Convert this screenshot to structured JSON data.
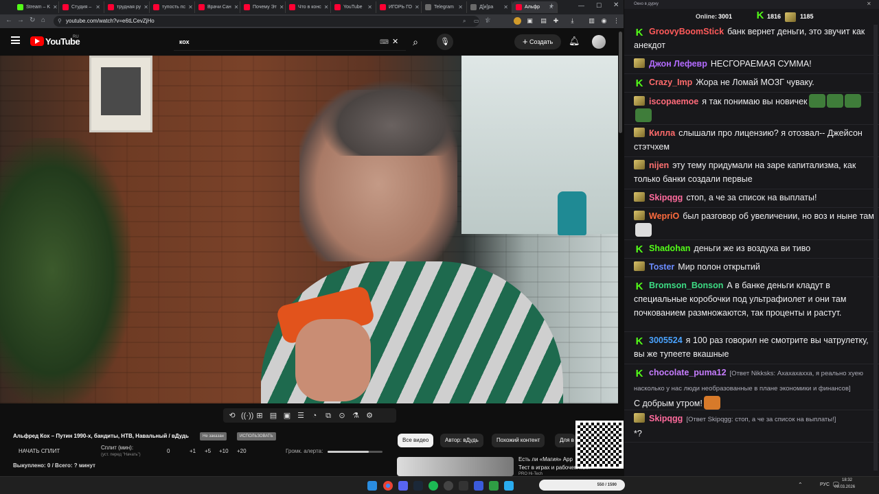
{
  "browser": {
    "tabs": [
      {
        "label": "Stream – K",
        "color": "#53fc18"
      },
      {
        "label": "Студия –",
        "color": "#ff0033"
      },
      {
        "label": "трудная ру",
        "color": "#ff0033"
      },
      {
        "label": "тупость пс",
        "color": "#ff0033"
      },
      {
        "label": "Врачи Сан",
        "color": "#ff0033"
      },
      {
        "label": "Почему Эт",
        "color": "#ff0033"
      },
      {
        "label": "Что в конс",
        "color": "#ff0033"
      },
      {
        "label": "YouTube",
        "color": "#ff0033"
      },
      {
        "label": "ИГОРЬ ГО",
        "color": "#ff0033"
      },
      {
        "label": "Telegram",
        "color": "#6a6a6a"
      },
      {
        "label": "Д[и]ра",
        "color": "#6a6a6a"
      },
      {
        "label": "Альфр",
        "color": "#ff0033"
      }
    ],
    "new_tab": "+",
    "url": "youtube.com/watch?v=e6tLCevZjHo"
  },
  "youtube": {
    "logo": "YouTube",
    "region": "RU",
    "search_value": "кох",
    "create_label": "Создать",
    "icons": [
      "menu-icon",
      "search-icon",
      "mic-icon",
      "bell-icon"
    ]
  },
  "panel": {
    "video_title": "Альфред Кох – Путин 1990-х, бандиты, НТВ, Навальный / вДудь",
    "chip1": "Не заказан",
    "chip2": "ИСПОЛЬЗОВАТЬ",
    "start_split": "НАЧАТЬ СПЛИТ",
    "split_label": "Сплит (мин):",
    "split_hint": "(уст. перед \"Начать\")",
    "split_values": [
      "0",
      "+1",
      "+5",
      "+10",
      "+20"
    ],
    "alert_label": "Громк. алерта:",
    "alert_level": 0.75,
    "bought": "Выкуплено: 0 / Всего: ? минут",
    "filters": [
      "Все видео",
      "Автор: вДудь",
      "Похожий контент",
      "Для в"
    ],
    "rec_title": "Есть ли «Магия» App",
    "rec_sub": "Тест в играх и рабочем по...",
    "rec_channel": "PRO Hi-Tech"
  },
  "chat": {
    "window_title": "Окно в дурку",
    "online_label": "Online:",
    "online_value": "3001",
    "count1": "1816",
    "count2": "1185",
    "messages": [
      {
        "badge": "k",
        "user": "GroovyBoomStick",
        "color": "#ff5a5a",
        "text": "банк вернет деньги, это звучит как анекдот"
      },
      {
        "badge": "m",
        "user": "Джон Лефевр",
        "color": "#b36bff",
        "text": "НЕСГОРАЕМАЯ СУММА!"
      },
      {
        "badge": "k",
        "user": "Crazy_Imp",
        "color": "#ff6b6b",
        "text": "Жора не Ломай МОЗГ чуваку."
      },
      {
        "badge": "m",
        "user": "iscopaemoe",
        "color": "#ff6b7a",
        "text": "я так понимаю вы новичек"
      },
      {
        "badge": "m",
        "user": "Килла",
        "color": "#ff6b6b",
        "text": "слышали про лицензию? я отозвал-- Джейсон стэтчхем"
      },
      {
        "badge": "m",
        "user": "nijen",
        "color": "#ff7070",
        "text": "эту тему придумали на заре капитализма, как только банки создали первые"
      },
      {
        "badge": "m",
        "user": "Skipqgg",
        "color": "#ff6b9d",
        "text": "стоп, а че за список на выплаты!"
      },
      {
        "badge": "m",
        "user": "WepriO",
        "color": "#ff6b3d",
        "text": "был разговор об увеличении, но воз и ныне там"
      },
      {
        "badge": "k",
        "user": "Shadohan",
        "color": "#53fc18",
        "text": "деньги же из воздуха ви тиво"
      },
      {
        "badge": "m",
        "user": "Toster",
        "color": "#6b8cff",
        "text": "Мир полон открытий"
      },
      {
        "badge": "k",
        "user": "Bromson_Bonson",
        "color": "#3ddc84",
        "text": "А в банке деньги кладут в специальные коробочки под ультрафиолет и они там почкованием размножаются, так проценты и растут."
      },
      {
        "badge": "k",
        "user": "3005524",
        "color": "#4aa3ff",
        "text": "я 100 раз говорил не смотрите вы чатрулетку, вы же тупеете вкашные"
      },
      {
        "badge": "k",
        "user": "chocolate_puma12",
        "color": "#c77dff",
        "reply": "[Ответ Nikksks: Ахахахахха, я реально хуею насколько у нас люди необразованные в плане экономики и финансов]",
        "text": "С добрым утром!"
      },
      {
        "badge": "m",
        "user": "Skipqgg",
        "color": "#ff6b9d",
        "reply": "[Ответ Skipqgg: стоп, а че за список на выплаты!]",
        "text": "*?"
      }
    ]
  },
  "taskbar": {
    "lang": "РУС",
    "time": "18:32",
    "date": "09.03.2026",
    "widget": "550 / 1590"
  }
}
